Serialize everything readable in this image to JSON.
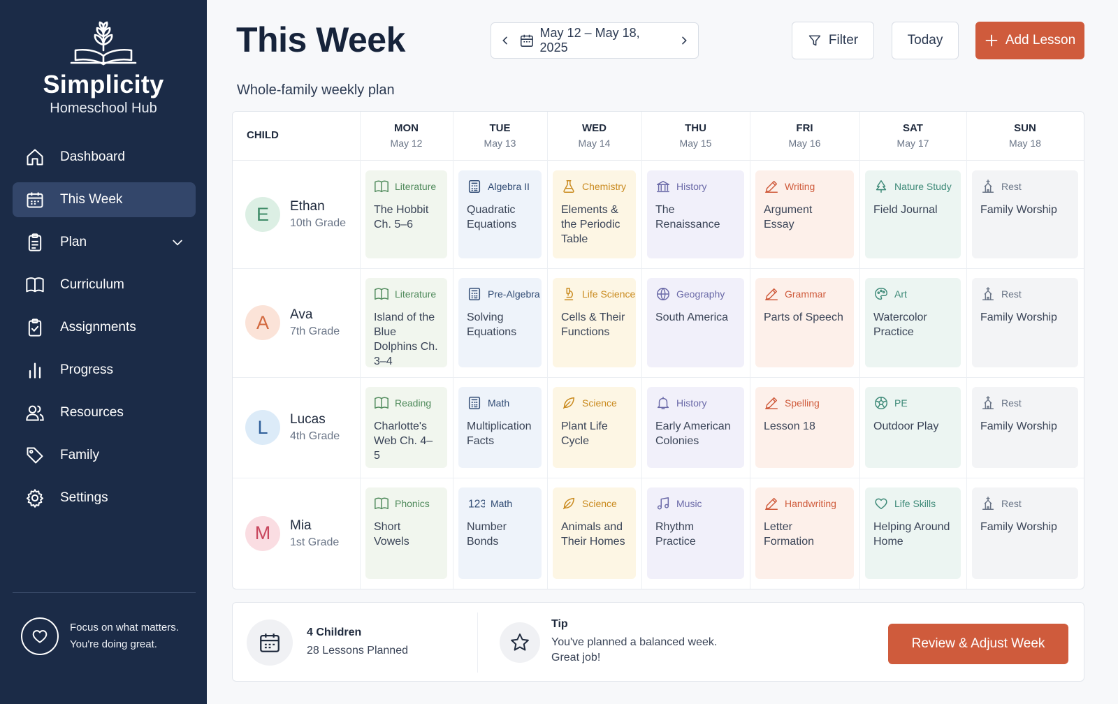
{
  "brand": {
    "name": "Simplicity",
    "subtitle": "Homeschool Hub"
  },
  "nav": {
    "items": [
      {
        "label": "Dashboard",
        "icon": "home-icon"
      },
      {
        "label": "This Week",
        "icon": "calendar-icon",
        "active": true
      },
      {
        "label": "Plan",
        "icon": "clipboard-icon",
        "has_submenu": true
      },
      {
        "label": "Curriculum",
        "icon": "book-icon"
      },
      {
        "label": "Assignments",
        "icon": "clipboard-check-icon"
      },
      {
        "label": "Progress",
        "icon": "bar-chart-icon"
      },
      {
        "label": "Resources",
        "icon": "people-icon"
      },
      {
        "label": "Family",
        "icon": "tag-icon"
      },
      {
        "label": "Settings",
        "icon": "gear-icon"
      }
    ]
  },
  "focus": {
    "line1": "Focus on what matters.",
    "line2": "You're doing great."
  },
  "header": {
    "title": "This Week",
    "date_range": "May 12 – May 18, 2025",
    "filter_label": "Filter",
    "today_label": "Today",
    "add_label": "Add Lesson",
    "subtitle": "Whole-family weekly plan"
  },
  "grid": {
    "child_header": "CHILD",
    "days": [
      {
        "name": "MON",
        "date": "May 12"
      },
      {
        "name": "TUE",
        "date": "May 13"
      },
      {
        "name": "WED",
        "date": "May 14"
      },
      {
        "name": "THU",
        "date": "May 15"
      },
      {
        "name": "FRI",
        "date": "May 16"
      },
      {
        "name": "SAT",
        "date": "May 17"
      },
      {
        "name": "SUN",
        "date": "May 18"
      }
    ],
    "children": [
      {
        "initial": "E",
        "name": "Ethan",
        "grade": "10th Grade",
        "lessons": [
          {
            "subject": "Literature",
            "title": "The Hobbit Ch. 5–6",
            "icon": "book-icon"
          },
          {
            "subject": "Algebra II",
            "title": "Quadratic Equations",
            "icon": "calculator-icon"
          },
          {
            "subject": "Chemistry",
            "title": "Elements & the Periodic Table",
            "icon": "flask-icon"
          },
          {
            "subject": "History",
            "title": "The Renaissance",
            "icon": "museum-icon"
          },
          {
            "subject": "Writing",
            "title": "Argument Essay",
            "icon": "pencil-icon"
          },
          {
            "subject": "Nature Study",
            "title": "Field Journal",
            "icon": "tree-icon"
          },
          {
            "subject": "Rest",
            "title": "Family Worship",
            "icon": "church-icon"
          }
        ]
      },
      {
        "initial": "A",
        "name": "Ava",
        "grade": "7th Grade",
        "lessons": [
          {
            "subject": "Literature",
            "title": "Island of the Blue Dolphins Ch. 3–4",
            "icon": "book-icon"
          },
          {
            "subject": "Pre-Algebra",
            "title": "Solving Equations",
            "icon": "calculator-icon"
          },
          {
            "subject": "Life Science",
            "title": "Cells & Their Functions",
            "icon": "microscope-icon"
          },
          {
            "subject": "Geography",
            "title": "South America",
            "icon": "globe-icon"
          },
          {
            "subject": "Grammar",
            "title": "Parts of Speech",
            "icon": "pencil-icon"
          },
          {
            "subject": "Art",
            "title": "Watercolor Practice",
            "icon": "palette-icon"
          },
          {
            "subject": "Rest",
            "title": "Family Worship",
            "icon": "church-icon"
          }
        ]
      },
      {
        "initial": "L",
        "name": "Lucas",
        "grade": "4th Grade",
        "lessons": [
          {
            "subject": "Reading",
            "title": "Charlotte's Web Ch. 4–5",
            "icon": "book-icon"
          },
          {
            "subject": "Math",
            "title": "Multiplication Facts",
            "icon": "calculator-icon"
          },
          {
            "subject": "Science",
            "title": "Plant Life Cycle",
            "icon": "leaf-icon"
          },
          {
            "subject": "History",
            "title": "Early American Colonies",
            "icon": "bell-icon"
          },
          {
            "subject": "Spelling",
            "title": "Lesson 18",
            "icon": "pencil-icon"
          },
          {
            "subject": "PE",
            "title": "Outdoor Play",
            "icon": "soccer-ball-icon"
          },
          {
            "subject": "Rest",
            "title": "Family Worship",
            "icon": "church-icon"
          }
        ]
      },
      {
        "initial": "M",
        "name": "Mia",
        "grade": "1st Grade",
        "lessons": [
          {
            "subject": "Phonics",
            "title": "Short Vowels",
            "icon": "book-icon"
          },
          {
            "subject": "Math",
            "title": "Number Bonds",
            "icon": "numbers-icon"
          },
          {
            "subject": "Science",
            "title": "Animals and Their Homes",
            "icon": "leaf-icon"
          },
          {
            "subject": "Music",
            "title": "Rhythm Practice",
            "icon": "music-note-icon"
          },
          {
            "subject": "Handwriting",
            "title": "Letter Formation",
            "icon": "pencil-icon"
          },
          {
            "subject": "Life Skills",
            "title": "Helping Around Home",
            "icon": "heart-icon"
          },
          {
            "subject": "Rest",
            "title": "Family Worship",
            "icon": "church-icon"
          }
        ]
      }
    ]
  },
  "footer": {
    "children_count": "4 Children",
    "lessons_planned": "28 Lessons Planned",
    "tip_label": "Tip",
    "tip_line1": "You've planned a balanced week.",
    "tip_line2": "Great job!",
    "review_label": "Review & Adjust Week"
  },
  "colors": {
    "sidebar": "#1b2b47",
    "accent": "#cf5b3c",
    "days": [
      "#4f8a5b",
      "#2f4a73",
      "#c98a1e",
      "#6b6aa8",
      "#cf5b3c",
      "#3e8a78",
      "#6a7587"
    ],
    "cell_backgrounds": [
      "#f1f6ee",
      "#eef3fa",
      "#fdf6e4",
      "#f1f0fa",
      "#fdf0ea",
      "#ecf5f2",
      "#f3f4f6"
    ],
    "avatars": [
      {
        "bg": "#dcefe4",
        "fg": "#3f8c68"
      },
      {
        "bg": "#fbe3d8",
        "fg": "#d2693f"
      },
      {
        "bg": "#dcebf8",
        "fg": "#2f5f9a"
      },
      {
        "bg": "#fadde2",
        "fg": "#c8475e"
      }
    ]
  }
}
